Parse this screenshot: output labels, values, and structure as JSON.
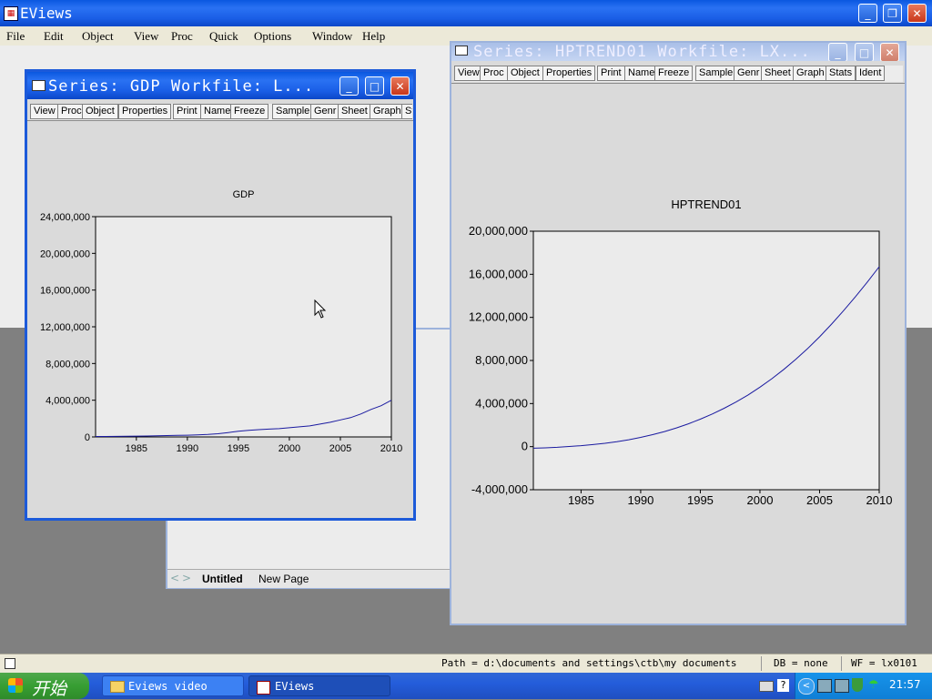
{
  "app": {
    "title": "EViews"
  },
  "menu": [
    "File",
    "Edit",
    "Object",
    "View",
    "Proc",
    "Quick",
    "Options",
    "Window",
    "Help"
  ],
  "window_gdp": {
    "title": "Series: GDP   Workfile: L...",
    "toolbar": [
      "View",
      "Proc",
      "Object",
      "Properties",
      "Print",
      "Name",
      "Freeze",
      "Sample",
      "Genr",
      "Sheet",
      "Graph",
      "St"
    ]
  },
  "window_hp": {
    "title": "Series: HPTREND01   Workfile: LX...",
    "toolbar": [
      "View",
      "Proc",
      "Object",
      "Properties",
      "Print",
      "Name",
      "Freeze",
      "Sample",
      "Genr",
      "Sheet",
      "Graph",
      "Stats",
      "Ident"
    ]
  },
  "workfile_tabs": [
    "Untitled",
    "New Page"
  ],
  "status": {
    "path": "Path = d:\\documents and settings\\ctb\\my documents",
    "db": "DB = none",
    "wf": "WF = lx0101"
  },
  "taskbar": {
    "start": "开始",
    "items": [
      "Eviews video",
      "EViews"
    ],
    "clock": "21:57"
  },
  "chart_data": [
    {
      "type": "line",
      "title": "GDP",
      "x": [
        1981,
        1982,
        1983,
        1984,
        1985,
        1986,
        1987,
        1988,
        1989,
        1990,
        1991,
        1992,
        1993,
        1994,
        1995,
        1996,
        1997,
        1998,
        1999,
        2000,
        2001,
        2002,
        2003,
        2004,
        2005,
        2006,
        2007,
        2008,
        2009,
        2010
      ],
      "values": [
        49000,
        53000,
        60000,
        72000,
        90000,
        102000,
        121000,
        150000,
        170000,
        187000,
        219000,
        270000,
        350000,
        480000,
        610000,
        720000,
        790000,
        850000,
        900000,
        1000000,
        1100000,
        1200000,
        1400000,
        1600000,
        1850000,
        2100000,
        2500000,
        3000000,
        3400000,
        4000000
      ],
      "xticks": [
        "1985",
        "1990",
        "1995",
        "2000",
        "2005",
        "2010"
      ],
      "yticks": [
        "0",
        "4,000,000",
        "8,000,000",
        "12,000,000",
        "16,000,000",
        "20,000,000",
        "24,000,000"
      ],
      "ylim": [
        0,
        24000000
      ],
      "xlim": [
        1981,
        2010
      ]
    },
    {
      "type": "line",
      "title": "HPTREND01",
      "x": [
        1981,
        1982,
        1983,
        1984,
        1985,
        1986,
        1987,
        1988,
        1989,
        1990,
        1991,
        1992,
        1993,
        1994,
        1995,
        1996,
        1997,
        1998,
        1999,
        2000,
        2001,
        2002,
        2003,
        2004,
        2005,
        2006,
        2007,
        2008,
        2009,
        2010
      ],
      "values": [
        -150000,
        -110000,
        -60000,
        10000,
        90000,
        190000,
        310000,
        460000,
        640000,
        860000,
        1110000,
        1400000,
        1740000,
        2120000,
        2550000,
        3030000,
        3560000,
        4150000,
        4800000,
        5520000,
        6310000,
        7170000,
        8100000,
        9110000,
        10200000,
        11370000,
        12610000,
        13910000,
        15280000,
        16700000
      ],
      "xticks": [
        "1985",
        "1990",
        "1995",
        "2000",
        "2005",
        "2010"
      ],
      "yticks": [
        "-4,000,000",
        "0",
        "4,000,000",
        "8,000,000",
        "12,000,000",
        "16,000,000",
        "20,000,000"
      ],
      "ylim": [
        -4000000,
        20000000
      ],
      "xlim": [
        1981,
        2010
      ]
    }
  ]
}
